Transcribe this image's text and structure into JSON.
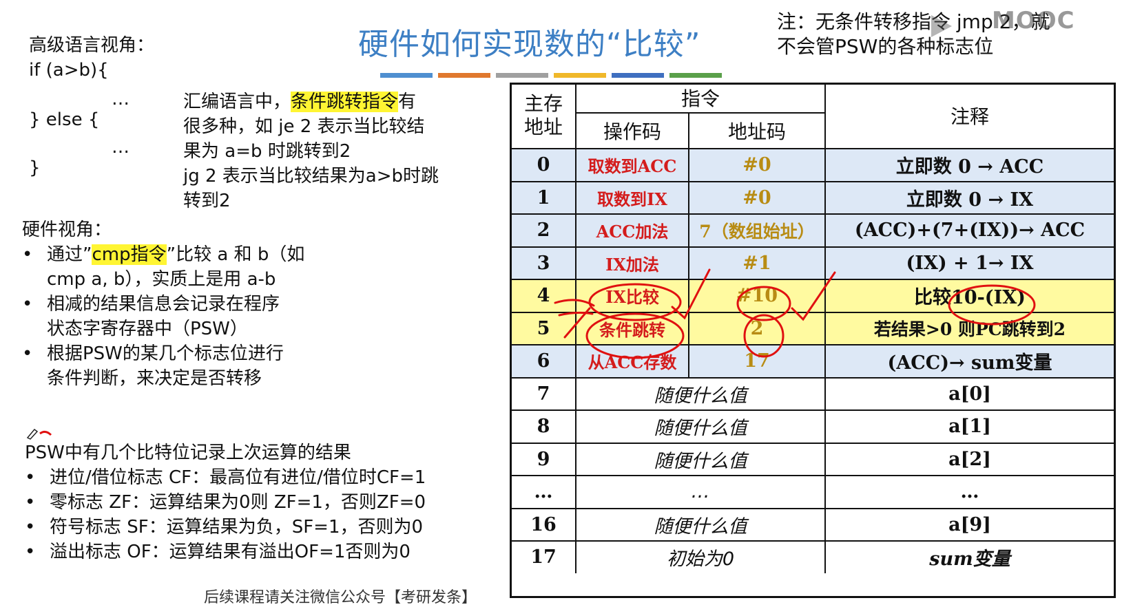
{
  "title": "硬件如何实现数的“比较”",
  "title_bar_colors": [
    "#4f8fd0",
    "#e0782e",
    "#a0a0a0",
    "#f0b82a",
    "#3f6fc0",
    "#5aa04a"
  ],
  "note": {
    "line1": "注：无条件转移指令 jmp 2，就",
    "line2": "不会管PSW的各种标志位"
  },
  "watermark": "MOOC",
  "left": {
    "high_level_heading": "高级语言视角：",
    "code": [
      "if (a>b){",
      "…",
      "} else {",
      "…",
      "}"
    ],
    "asm_note": {
      "line1_pre": "汇编语言中，",
      "line1_hl": "条件跳转指令",
      "line1_post": "有",
      "line2": "很多种，如 je 2 表示当比较结",
      "line3": "果为 a=b 时跳转到2",
      "line4": "jg 2 表示当比较结果为a>b时跳",
      "line5": "转到2"
    },
    "hardware_heading": "硬件视角：",
    "hw_bullets": {
      "b1_pre": "通过”",
      "b1_hl": "cmp指令",
      "b1_post": "”比较 a 和 b（如",
      "b1_line2": "cmp a, b），实质上是用 a-b",
      "b2_line1": "相减的结果信息会记录在程序",
      "b2_line2": "状态字寄存器中（PSW）",
      "b3_line1": "根据PSW的某几个标志位进行",
      "b3_line2": "条件判断，来决定是否转移"
    },
    "psw_heading": "PSW中有几个比特位记录上次运算的结果",
    "flags": [
      "进位/借位标志 CF：最高位有进位/借位时CF=1",
      "零标志 ZF：运算结果为0则 ZF=1，否则ZF=0",
      "符号标志 SF：运算结果为负，SF=1，否则为0",
      "溢出标志 OF：运算结果有溢出OF=1否则为0"
    ],
    "bullet_char": "•"
  },
  "table": {
    "headers": {
      "addr": "主存\n地址",
      "instr": "指令",
      "opcode": "操作码",
      "operand": "地址码",
      "comment": "注释"
    },
    "rows": [
      {
        "addr": "0",
        "op": "取数到ACC",
        "operand": "#0",
        "comment": "立即数 0 → ACC"
      },
      {
        "addr": "1",
        "op": "取数到IX",
        "operand": "#0",
        "comment": "立即数 0 → IX"
      },
      {
        "addr": "2",
        "op": "ACC加法",
        "operand": "7（数组始址）",
        "comment": "(ACC)+(7+(IX))→ ACC"
      },
      {
        "addr": "3",
        "op": "IX加法",
        "operand": "#1",
        "comment": "(IX) + 1→ IX"
      },
      {
        "addr": "4",
        "op": "IX比较",
        "operand": "#10",
        "comment": "比较10-(IX)"
      },
      {
        "addr": "5",
        "op": "条件跳转",
        "operand": "2",
        "comment": "若结果>0 则PC跳转到2"
      },
      {
        "addr": "6",
        "op": "从ACC存数",
        "operand": "17",
        "comment": "(ACC)→ sum变量"
      },
      {
        "addr": "7",
        "merged": "随便什么值",
        "comment": "a[0]"
      },
      {
        "addr": "8",
        "merged": "随便什么值",
        "comment": "a[1]"
      },
      {
        "addr": "9",
        "merged": "随便什么值",
        "comment": "a[2]"
      },
      {
        "addr": "…",
        "merged": "…",
        "comment": "…"
      },
      {
        "addr": "16",
        "merged": "随便什么值",
        "comment": "a[9]"
      },
      {
        "addr": "17",
        "merged": "初始为0",
        "comment": "sum变量"
      }
    ],
    "colors": {
      "blue_row": "#dde8f6",
      "yellow_row": "#fffaa0",
      "op_red": "#d41c1c",
      "operand_gold": "#b88c14",
      "annotation_red": "#e01010"
    }
  },
  "footer": "后续课程请关注微信公众号【考研发条】"
}
